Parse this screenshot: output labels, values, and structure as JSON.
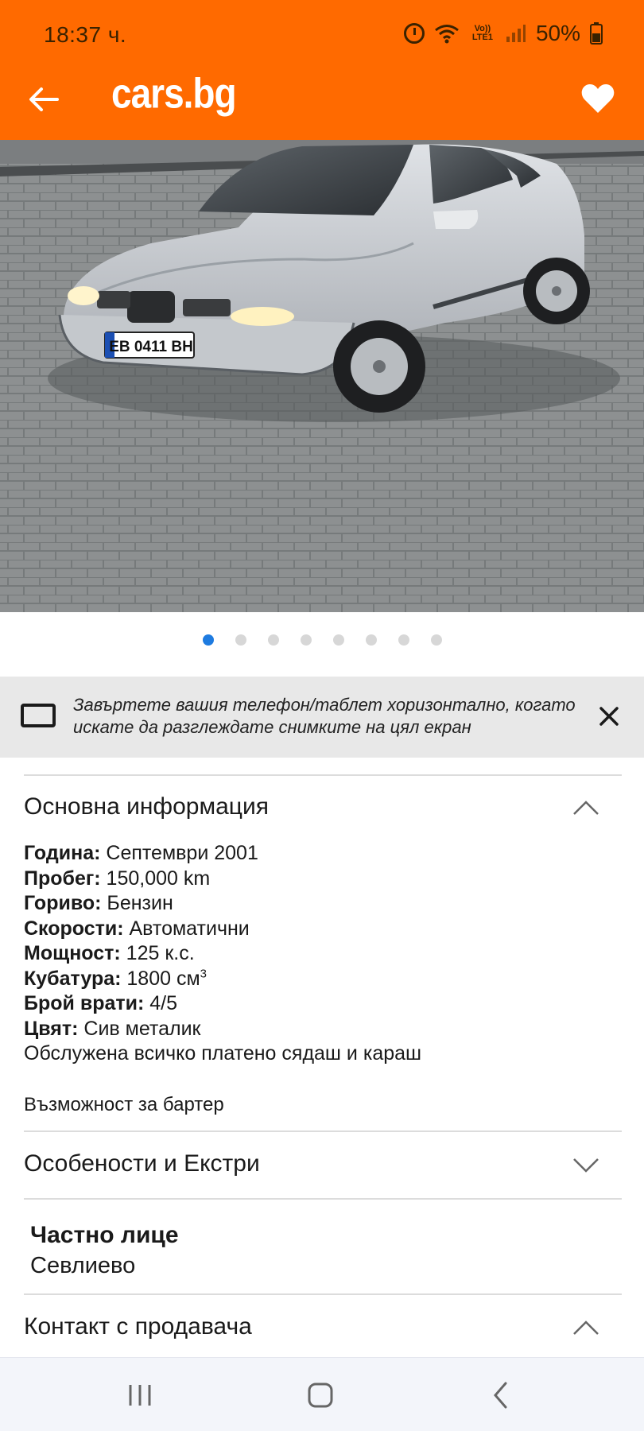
{
  "status_bar": {
    "time": "18:37 ч.",
    "volte_label": "Vo)) LTE1",
    "battery": "50%",
    "icons": [
      "alarm-icon",
      "wifi-icon",
      "signal-icon",
      "battery-icon"
    ]
  },
  "app_bar": {
    "logo": "cars.bg",
    "back_icon": "arrow-left-icon",
    "favorite_icon": "heart-icon",
    "background_color": "#ff6a00"
  },
  "gallery": {
    "total_images": 8,
    "current_index": 1,
    "plate_text": "EB 0411 BH",
    "active_dot_color": "#1e7be0"
  },
  "rotate_tip": {
    "text": "Завъртете вашия телефон/таблет хоризонтално, когато искате да разглеждате снимките на цял екран",
    "close_icon": "close-icon"
  },
  "basic_info": {
    "title": "Основна информация",
    "expanded": true,
    "rows": [
      {
        "label": "Година:",
        "value": " Септември 2001"
      },
      {
        "label": "Пробег:",
        "value": " 150,000 km"
      },
      {
        "label": "Гориво:",
        "value": " Бензин"
      },
      {
        "label": "Скорости:",
        "value": " Автоматични"
      },
      {
        "label": "Мощност:",
        "value": " 125 к.с."
      },
      {
        "label": "Кубатура:",
        "value": " 1800 см",
        "sup": "3"
      },
      {
        "label": "Брой врати:",
        "value": " 4/5"
      },
      {
        "label": "Цвят:",
        "value": " Сив металик"
      }
    ],
    "description": "Обслужена всичко платено сядаш и караш",
    "barter": "Възможност за бартер"
  },
  "features": {
    "title": "Особености и Екстри",
    "expanded": false
  },
  "seller": {
    "type": "Частно лице",
    "city": "Севлиево"
  },
  "contact": {
    "title": "Контакт с продавача",
    "expanded": true
  },
  "nav_bar": {
    "icons": [
      "recent-apps-icon",
      "home-icon",
      "back-icon"
    ]
  }
}
